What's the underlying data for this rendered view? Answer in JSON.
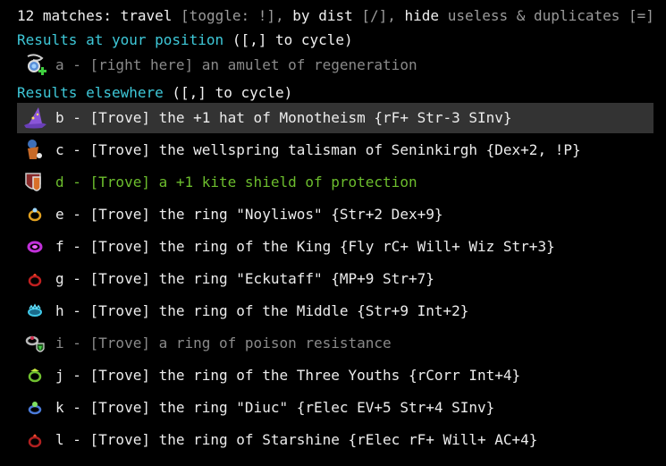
{
  "header": {
    "count": "12 matches:",
    "travel": "travel",
    "toggle": "[toggle: !],",
    "by": "by",
    "dist": "dist",
    "dist_key": "[/],",
    "hide": "hide",
    "useless": "useless & duplicates",
    "hide_key": "[=]"
  },
  "here_section": {
    "title": "Results at your position",
    "hint": " ([,] to cycle)"
  },
  "elsewhere_section": {
    "title": "Results elsewhere",
    "hint": " ([,] to cycle)"
  },
  "here_items": [
    {
      "text": "a - [right here] an amulet of regeneration",
      "icon": "amulet-icon",
      "color": "#8a8a8a"
    }
  ],
  "items": [
    {
      "text": "b - [Trove] the +1 hat of Monotheism {rF+ Str-3 SInv}",
      "icon": "wizard-hat-icon",
      "color": "#ececec",
      "selected": true
    },
    {
      "text": "c - [Trove] the wellspring talisman of Seninkirgh {Dex+2, !P}",
      "icon": "talisman-icon",
      "color": "#ececec"
    },
    {
      "text": "d - [Trove] a +1 kite shield of protection",
      "icon": "kite-shield-icon",
      "color": "#6cbd2d"
    },
    {
      "text": "e - [Trove] the ring \"Noyliwos\" {Str+2 Dex+9}",
      "icon": "ring-icon",
      "color": "#ececec"
    },
    {
      "text": "f - [Trove] the ring of the King {Fly rC+ Will+ Wiz Str+3}",
      "icon": "ring-icon",
      "color": "#ececec"
    },
    {
      "text": "g - [Trove] the ring \"Eckutaff\" {MP+9 Str+7}",
      "icon": "ring-icon",
      "color": "#ececec"
    },
    {
      "text": "h - [Trove] the ring of the Middle {Str+9 Int+2}",
      "icon": "ring-icon",
      "color": "#ececec"
    },
    {
      "text": "i - [Trove] a ring of poison resistance",
      "icon": "poison-ring-icon",
      "color": "#8a8a8a"
    },
    {
      "text": "j - [Trove] the ring of the Three Youths {rCorr Int+4}",
      "icon": "ring-icon",
      "color": "#ececec"
    },
    {
      "text": "k - [Trove] the ring \"Diuc\" {rElec EV+5 Str+4 SInv}",
      "icon": "ring-icon",
      "color": "#ececec"
    },
    {
      "text": "l - [Trove] the ring of Starshine {rElec rF+ Will+ AC+4}",
      "icon": "ring-icon",
      "color": "#ececec"
    }
  ]
}
